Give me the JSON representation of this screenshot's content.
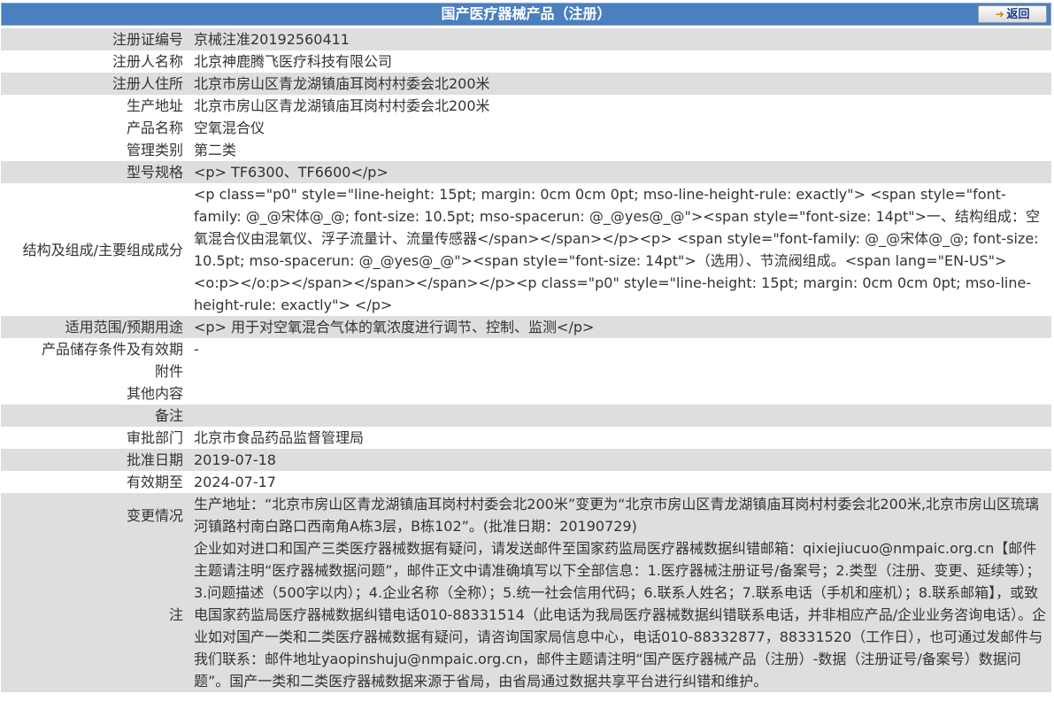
{
  "header": {
    "title": "国产医疗器械产品（注册）",
    "back_label": "返回",
    "back_icon": "arrow-right-icon"
  },
  "fields": {
    "reg_no": {
      "label": "注册证编号",
      "value": "京械注准20192560411"
    },
    "registrant_name": {
      "label": "注册人名称",
      "value": "北京神鹿腾飞医疗科技有限公司"
    },
    "registrant_address": {
      "label": "注册人住所",
      "value": "北京市房山区青龙湖镇庙耳岗村村委会北200米"
    },
    "production_address": {
      "label": "生产地址",
      "value": "北京市房山区青龙湖镇庙耳岗村村委会北200米"
    },
    "product_name": {
      "label": "产品名称",
      "value": "空氧混合仪"
    },
    "management_class": {
      "label": "管理类别",
      "value": "第二类"
    },
    "model_spec": {
      "label": "型号规格",
      "value": "<p> TF6300、TF6600</p>"
    },
    "structure": {
      "label": "结构及组成/主要组成成分",
      "value": "<p class=\"p0\" style=\"line-height: 15pt; margin: 0cm 0cm 0pt; mso-line-height-rule: exactly\"> <span style=\"font-family: @_@宋体@_@; font-size: 10.5pt; mso-spacerun: @_@yes@_@\"><span style=\"font-size: 14pt\">一、结构组成：空氧混合仪由混氧仪、浮子流量计、流量传感器</span></span></p><p> <span style=\"font-family: @_@宋体@_@; font-size: 10.5pt; mso-spacerun: @_@yes@_@\"><span style=\"font-size: 14pt\">（选用）、节流阀组成。<span lang=\"EN-US\"><o:p></o:p></span></span></span></p><p class=\"p0\" style=\"line-height: 15pt; margin: 0cm 0cm 0pt; mso-line-height-rule: exactly\"> </p>"
    },
    "scope": {
      "label": "适用范围/预期用途",
      "value": "<p> 用于对空氧混合气体的氧浓度进行调节、控制、监测</p>"
    },
    "storage": {
      "label": "产品储存条件及有效期",
      "value": "-"
    },
    "attachment": {
      "label": "附件",
      "value": ""
    },
    "other": {
      "label": "其他内容",
      "value": ""
    },
    "remark": {
      "label": "备注",
      "value": ""
    },
    "approval_dept": {
      "label": "审批部门",
      "value": "北京市食品药品监督管理局"
    },
    "approval_date": {
      "label": "批准日期",
      "value": "2019-07-18"
    },
    "valid_until": {
      "label": "有效期至",
      "value": "2024-07-17"
    },
    "change": {
      "label": "变更情况",
      "value": "生产地址：“北京市房山区青龙湖镇庙耳岗村村委会北200米”变更为“北京市房山区青龙湖镇庙耳岗村村委会北200米,北京市房山区琉璃河镇路村南白路口西南角A栋3层，B栋102”。(批准日期：20190729)"
    },
    "note": {
      "label": "注",
      "value": "企业如对进口和国产三类医疗器械数据有疑问，请发送邮件至国家药监局医疗器械数据纠错邮箱：qixiejiucuo@nmpaic.org.cn【邮件主题请注明“医疗器械数据问题”，邮件正文中请准确填写以下全部信息：1.医疗器械注册证号/备案号；2.类型（注册、变更、延续等）；3.问题描述（500字以内）；4.企业名称（全称）；5.统一社会信用代码；6.联系人姓名；7.联系电话（手机和座机）；8.联系邮箱】，或致电国家药监局医疗器械数据纠错电话010-88331514（此电话为我局医疗器械数据纠错联系电话，并非相应产品/企业业务咨询电话）。企业如对国产一类和二类医疗器械数据有疑问，请咨询国家局信息中心，电话010-88332877，88331520（工作日），也可通过发邮件与我们联系：邮件地址yaopinshuju@nmpaic.org.cn，邮件主题请注明“国产医疗器械产品（注册）-数据（注册证号/备案号）数据问题”。国产一类和二类医疗器械数据来源于省局，由省局通过数据共享平台进行纠错和维护。"
    }
  },
  "colors": {
    "title_bg": "#4a7fc0",
    "row_alt": "#dedede",
    "note_text": "#1e3a9a",
    "back_text": "#1a3d8c",
    "back_arrow": "#e07b00"
  }
}
